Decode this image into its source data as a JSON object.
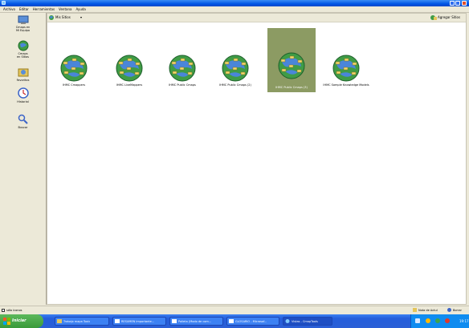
{
  "menu": [
    "Archivo",
    "Editar",
    "Herramientas",
    "Ventana",
    "Ayuda"
  ],
  "sidebar": [
    {
      "label": "Cmaps en\nMi Equipo",
      "icon": "computer-icon"
    },
    {
      "label": "Cmaps\nen Sitios",
      "icon": "network-globe-icon"
    },
    {
      "label": "Favoritos",
      "icon": "favorites-icon"
    },
    {
      "label": "Historial",
      "icon": "history-icon"
    },
    {
      "label": "Buscar",
      "icon": "search-icon"
    }
  ],
  "toolbar": {
    "location": "Mis Sitios",
    "add_site": "Agregar Sitios"
  },
  "sites": [
    {
      "label": "IHMC Cmappers",
      "selected": false
    },
    {
      "label": "IHMC LiveMappers",
      "selected": false
    },
    {
      "label": "IHMC Public Cmaps",
      "selected": false
    },
    {
      "label": "IHMC Public Cmaps (2)",
      "selected": false
    },
    {
      "label": "IHMC Public Cmaps (3)",
      "selected": true
    },
    {
      "label": "IHMC Sample Knowledge Models",
      "selected": false
    }
  ],
  "status": {
    "checkbox_label": "sólo íconos",
    "new_folder": "Nota de Actul",
    "delete": "Borrar"
  },
  "taskbar": {
    "start": "Iniciar",
    "tasks": [
      {
        "label": "Trabajo mapa Toxic",
        "active": false
      },
      {
        "label": "RESUMEN importante...",
        "active": false
      },
      {
        "label": "Palieta (Modo de com...",
        "active": false
      },
      {
        "label": "GLOSARIO - Microsof...",
        "active": false
      },
      {
        "label": "Vistas - CmapTools",
        "active": true
      }
    ],
    "clock": "19:17"
  },
  "colors": {
    "selected": "#8c9b63",
    "taskbar": "#245edb",
    "start": "#3a9a3a"
  }
}
